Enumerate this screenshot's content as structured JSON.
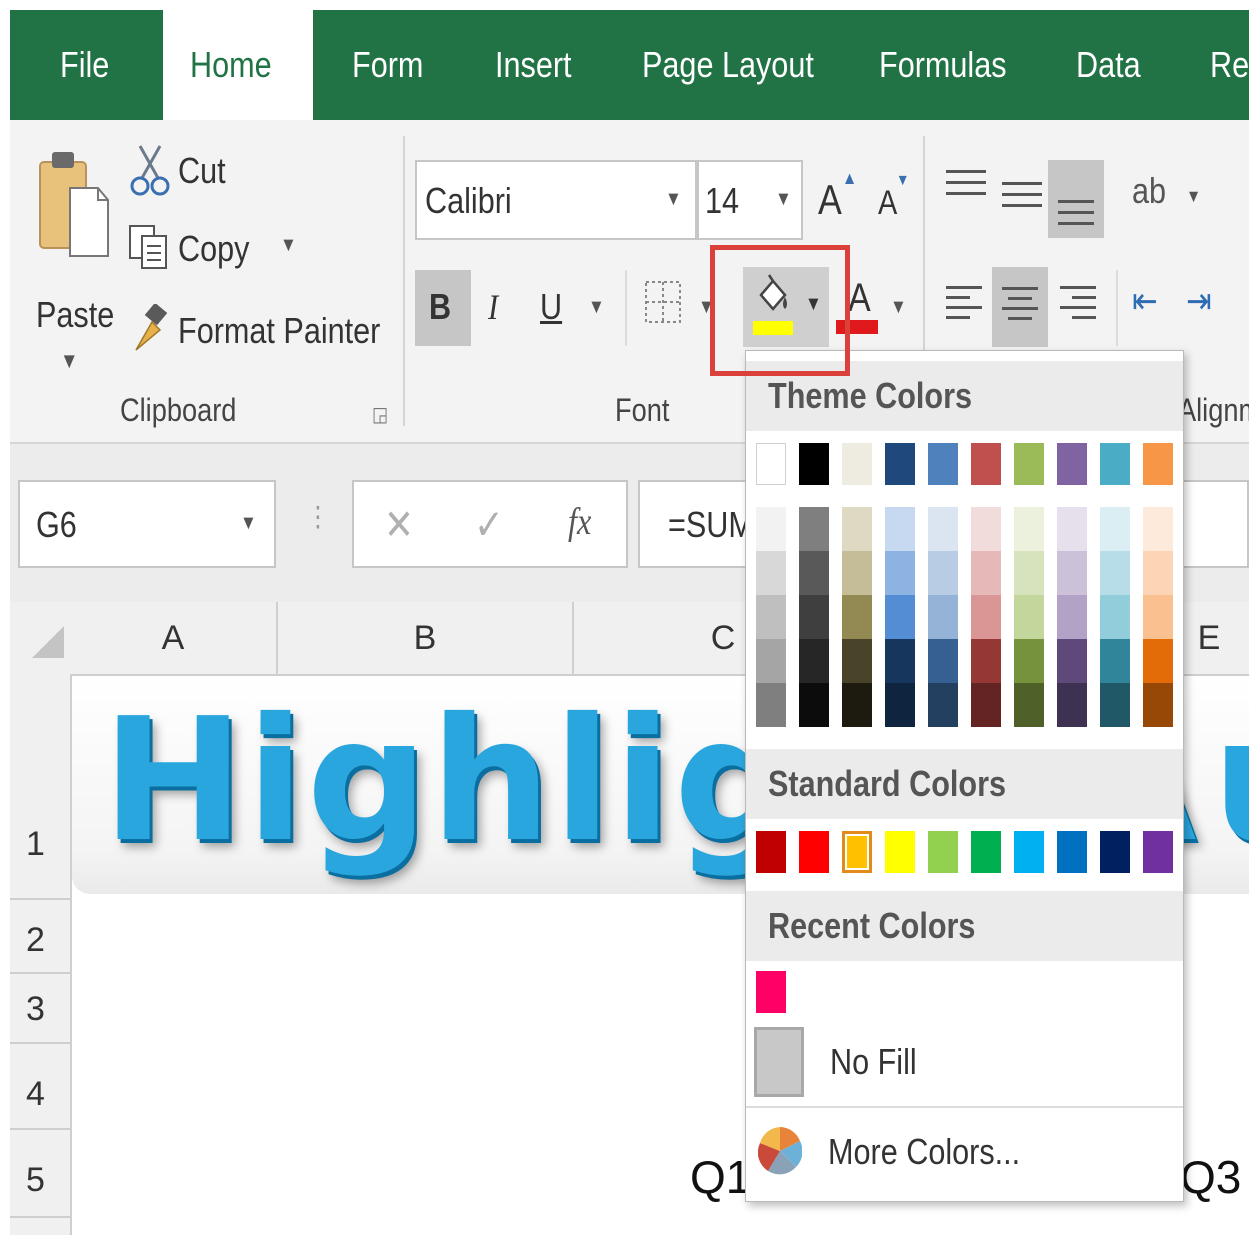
{
  "tabs": [
    {
      "label": "File",
      "active": false
    },
    {
      "label": "Home",
      "active": true
    },
    {
      "label": "Form",
      "active": false
    },
    {
      "label": "Insert",
      "active": false
    },
    {
      "label": "Page Layout",
      "active": false
    },
    {
      "label": "Formulas",
      "active": false
    },
    {
      "label": "Data",
      "active": false
    },
    {
      "label": "Re",
      "active": false
    }
  ],
  "clipboard": {
    "paste_label": "Paste",
    "cut_label": "Cut",
    "copy_label": "Copy",
    "format_painter_label": "Format Painter",
    "group_label": "Clipboard"
  },
  "font": {
    "font_name": "Calibri",
    "font_size": "14",
    "bold": "B",
    "italic": "I",
    "underline": "U",
    "grow": "A",
    "shrink": "A",
    "font_color_letter": "A",
    "font_color": "#e0191c",
    "fill_color": "#ffff00",
    "group_label": "Font"
  },
  "alignment": {
    "group_label": "Alignm"
  },
  "formula_bar": {
    "name_box": "G6",
    "cancel": "✕",
    "enter": "✓",
    "fx": "fx",
    "formula": "=SUM"
  },
  "sheet": {
    "columns": [
      "A",
      "B",
      "C",
      "E"
    ],
    "rows": [
      "1",
      "2",
      "3",
      "4",
      "5"
    ],
    "banner_text": "Highlight A",
    "banner_tail": "u",
    "cell_q1": "Q1",
    "cell_q3": "Q3"
  },
  "color_menu": {
    "theme_header": "Theme Colors",
    "standard_header": "Standard Colors",
    "recent_header": "Recent Colors",
    "no_fill_label": "No Fill",
    "more_colors_label": "More Colors...",
    "theme_base": [
      "#ffffff",
      "#000000",
      "#eeece1",
      "#1f497d",
      "#4f81bd",
      "#c0504d",
      "#9bbb59",
      "#8064a2",
      "#4bacc6",
      "#f79646"
    ],
    "theme_shades": [
      [
        "#f2f2f2",
        "#d8d8d8",
        "#bfbfbf",
        "#a5a5a5",
        "#7f7f7f"
      ],
      [
        "#7f7f7f",
        "#595959",
        "#3f3f3f",
        "#262626",
        "#0c0c0c"
      ],
      [
        "#ddd9c3",
        "#c4bd97",
        "#938953",
        "#494429",
        "#1d1b10"
      ],
      [
        "#c6d9f0",
        "#8db3e2",
        "#548dd4",
        "#17365d",
        "#0f243e"
      ],
      [
        "#dbe5f1",
        "#b8cce4",
        "#95b3d7",
        "#366092",
        "#244061"
      ],
      [
        "#f2dcdb",
        "#e5b9b7",
        "#d99694",
        "#953734",
        "#632423"
      ],
      [
        "#ebf1dd",
        "#d7e3bc",
        "#c3d69b",
        "#76923c",
        "#4f6128"
      ],
      [
        "#e5e0ec",
        "#ccc1d9",
        "#b2a2c7",
        "#5f497a",
        "#3f3151"
      ],
      [
        "#dbeef3",
        "#b7dde8",
        "#92cddc",
        "#31859b",
        "#205867"
      ],
      [
        "#fdeada",
        "#fbd5b5",
        "#fac08f",
        "#e36c09",
        "#974806"
      ]
    ],
    "standard": [
      "#c00000",
      "#ff0000",
      "#ffc000",
      "#ffff00",
      "#92d050",
      "#00b050",
      "#00b0f0",
      "#0070c0",
      "#002060",
      "#7030a0"
    ],
    "recent": [
      "#ff0066"
    ]
  },
  "icons": [
    "paste-icon",
    "scissors-icon",
    "copy-icon",
    "brush-icon",
    "fill-bucket-icon",
    "borders-icon",
    "color-wheel-icon"
  ]
}
